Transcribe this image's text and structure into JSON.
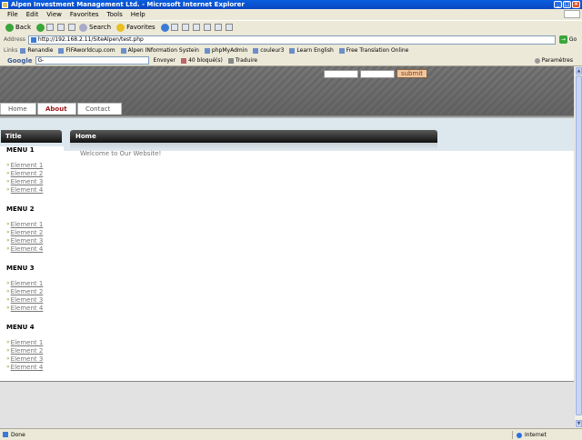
{
  "window": {
    "title": "Alpen Investment Management Ltd. - Microsoft Internet Explorer"
  },
  "menubar": {
    "items": [
      "File",
      "Edit",
      "View",
      "Favorites",
      "Tools",
      "Help"
    ]
  },
  "toolbar": {
    "back": "Back",
    "search": "Search",
    "favorites": "Favorites"
  },
  "address": {
    "label": "Address",
    "url": "http://192.168.2.11/SiteAlpen/test.php",
    "go": "Go"
  },
  "links": {
    "label": "Links",
    "items": [
      "Renandie",
      "FIFAworldcup.com",
      "Alpen INformation Systein",
      "phpMyAdmin",
      "couleur3",
      "Learn English",
      "Free Translation Online"
    ]
  },
  "googlebar": {
    "logo": "Google",
    "search_prefix": "G-",
    "send": "Envoyer",
    "blocked": "40 bloqué(s)",
    "translate": "Traduire",
    "settings": "Paramètres"
  },
  "site": {
    "submit_label": "submit",
    "tabs": [
      "Home",
      "About",
      "Contact"
    ],
    "left_title": "Title",
    "main_title": "Home",
    "welcome": "Welcome to Our Website!",
    "menus": [
      {
        "title": "MENU 1",
        "items": [
          "Element 1",
          "Element 2",
          "Element 3",
          "Element 4"
        ]
      },
      {
        "title": "MENU 2",
        "items": [
          "Element 1",
          "Element 2",
          "Element 3",
          "Element 4"
        ]
      },
      {
        "title": "MENU 3",
        "items": [
          "Element 1",
          "Element 2",
          "Element 3",
          "Element 4"
        ]
      },
      {
        "title": "MENU 4",
        "items": [
          "Element 1",
          "Element 2",
          "Element 3",
          "Element 4"
        ]
      }
    ]
  },
  "status": {
    "left": "Done",
    "zone": "Internet"
  }
}
